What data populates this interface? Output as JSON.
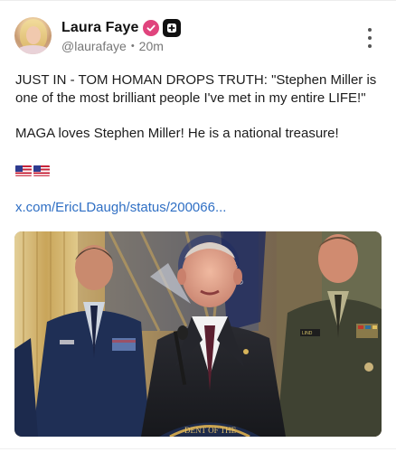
{
  "post": {
    "author": {
      "name": "Laura Faye",
      "handle": "@laurafaye",
      "time": "20m",
      "verified_icon": "verified-badge-icon",
      "subscribe_icon": "plus-box-icon"
    },
    "text_line_1": "JUST IN - TOM HOMAN DROPS TRUTH: \"Stephen Miller is one of the most brilliant people I've met in my entire LIFE!\"",
    "text_line_2": "MAGA loves Stephen Miller! He is a national treasure!",
    "emoji": "us-flag-icon x2",
    "link": "x.com/EricLDaugh/status/200066...",
    "seal_text": "DENT OF THE",
    "more_icon": "vertical-ellipsis-icon"
  },
  "colors": {
    "badge": "#e0447d",
    "link": "#2f6fc4",
    "handle": "#777777"
  }
}
